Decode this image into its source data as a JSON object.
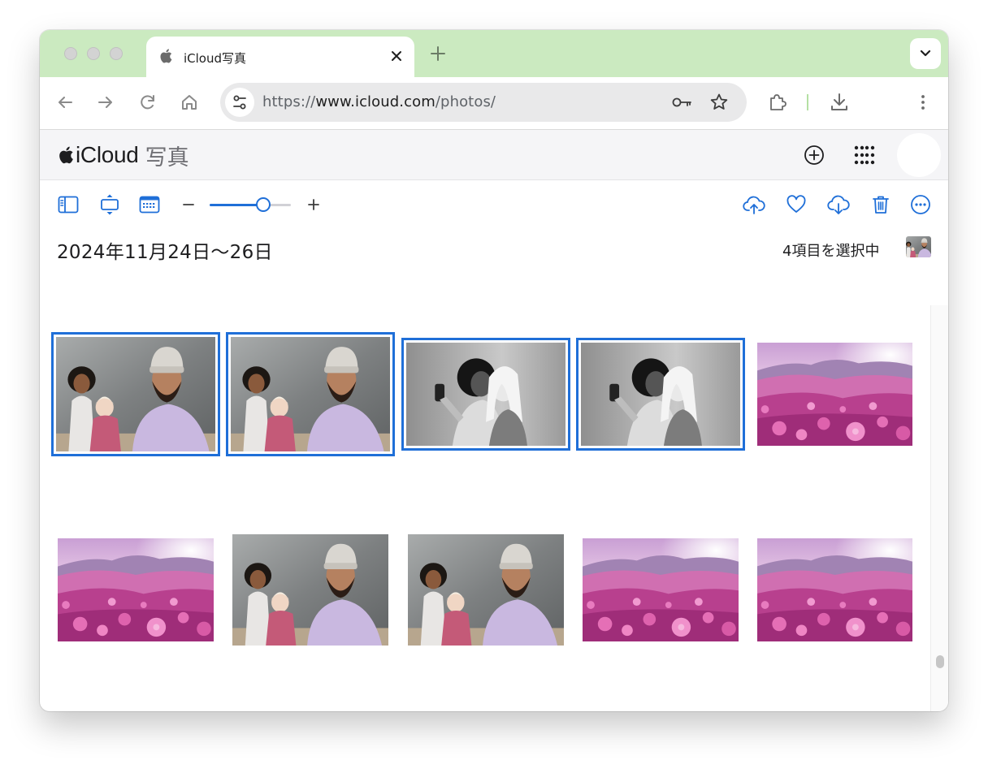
{
  "browser": {
    "tab_title": "iCloud写真",
    "url_scheme": "https://",
    "url_host": "www.icloud.com",
    "url_path": "/photos/"
  },
  "app": {
    "brand_name": "iCloud",
    "brand_section": "写真"
  },
  "photos": {
    "date_range": "2024年11月24日〜26日",
    "selection_text": "4項目を選択中",
    "zoom_level": 0.66,
    "items": [
      {
        "kind": "family-selfie",
        "selected": true
      },
      {
        "kind": "family-selfie",
        "selected": true
      },
      {
        "kind": "bw-selfie",
        "selected": true
      },
      {
        "kind": "bw-selfie",
        "selected": true
      },
      {
        "kind": "flower-field",
        "selected": false
      },
      {
        "kind": "flower-field",
        "selected": false
      },
      {
        "kind": "family-selfie",
        "selected": false
      },
      {
        "kind": "family-selfie",
        "selected": false
      },
      {
        "kind": "flower-field",
        "selected": false
      },
      {
        "kind": "flower-field",
        "selected": false
      }
    ]
  },
  "icons": {
    "browser": [
      "back-icon",
      "forward-icon",
      "reload-icon",
      "home-icon",
      "site-settings-icon",
      "password-key-icon",
      "bookmark-star-icon",
      "extensions-icon",
      "download-icon",
      "more-vertical-icon",
      "tab-search-icon",
      "new-tab-icon",
      "close-tab-icon"
    ],
    "app": [
      "add-circle-icon",
      "app-grid-icon"
    ],
    "photos_toolbar": [
      "sidebar-toggle-icon",
      "fit-icon",
      "calendar-grid-icon",
      "zoom-out-icon",
      "zoom-in-icon",
      "upload-icon",
      "favorite-heart-icon",
      "download-cloud-icon",
      "trash-icon",
      "more-circle-icon"
    ]
  },
  "colors": {
    "accent": "#1f6fd8",
    "tabstrip": "#cbeac0",
    "omnibox": "#e9e9ea",
    "app_header": "#f5f5f7"
  }
}
